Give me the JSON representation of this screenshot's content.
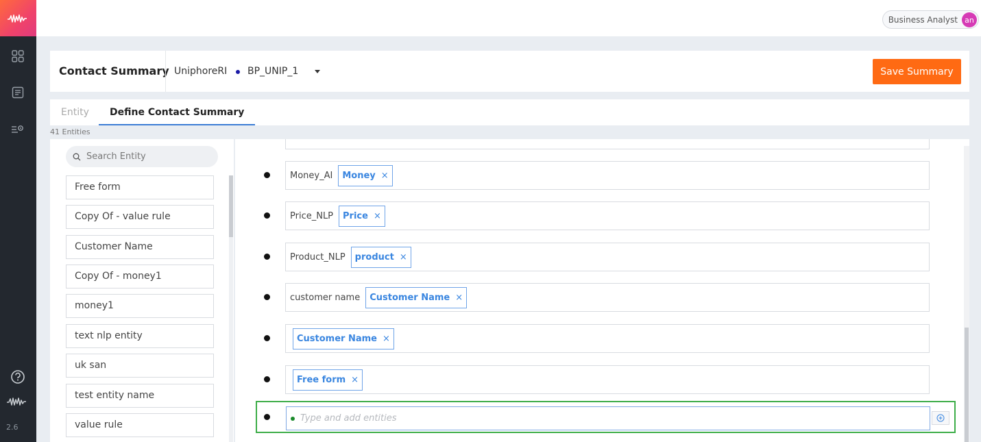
{
  "topbar": {
    "user_role": "Business Analyst",
    "user_initials": "an"
  },
  "rail": {
    "version": "2.6",
    "icons": [
      "dashboard-icon",
      "document-icon",
      "settings-list-icon",
      "help-icon",
      "brand-wave-icon"
    ]
  },
  "header": {
    "title": "Contact Summary",
    "project": "UniphoreRI",
    "bp_name": "BP_UNIP_1",
    "save_label": "Save Summary"
  },
  "tabs": [
    {
      "label": "Entity",
      "active": false
    },
    {
      "label": "Define Contact Summary",
      "active": true
    }
  ],
  "entity_count": "41 Entities",
  "search": {
    "placeholder": "Search Entity"
  },
  "entities": [
    "Free form",
    "Copy Of - value rule",
    "Customer Name",
    "Copy Of - money1",
    "money1",
    "text nlp entity",
    "uk san",
    "test entity name",
    "value rule"
  ],
  "summary_rows": [
    {
      "text": "Money_AI",
      "chip": "Money"
    },
    {
      "text": "Price_NLP",
      "chip": "Price"
    },
    {
      "text": "Product_NLP",
      "chip": "product"
    },
    {
      "text": "customer name",
      "chip": "Customer Name"
    },
    {
      "text": "",
      "chip": "Customer Name"
    },
    {
      "text": "",
      "chip": "Free form"
    }
  ],
  "new_row": {
    "placeholder": "Type and add entities"
  },
  "colors": {
    "accent": "#ff6a13",
    "chip_blue": "#3a86e0",
    "focus_green": "#3dad48",
    "rail_bg": "#23282f"
  }
}
